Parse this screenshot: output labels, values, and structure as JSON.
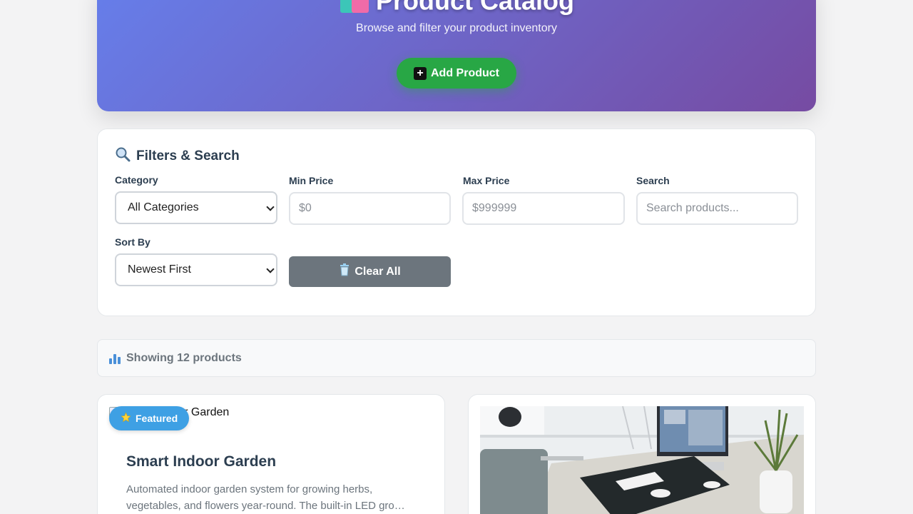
{
  "header": {
    "title": "Product Catalog",
    "subtitle": "Browse and filter your product inventory",
    "add_button": "Add Product"
  },
  "filters": {
    "title": "Filters & Search",
    "category_label": "Category",
    "category_value": "All Categories",
    "min_price_label": "Min Price",
    "min_price_placeholder": "$0",
    "max_price_label": "Max Price",
    "max_price_placeholder": "$999999",
    "search_label": "Search",
    "search_placeholder": "Search products...",
    "sort_label": "Sort By",
    "sort_value": "Newest First",
    "clear_button": "Clear All"
  },
  "results": {
    "count_text": "Showing 12 products"
  },
  "products": [
    {
      "image_alt": "Smart Indoor Garden",
      "badge": "Featured",
      "name": "Smart Indoor Garden",
      "description": "Automated indoor garden system for growing herbs, vegetables, and flowers year-round. The built-in LED gro…"
    }
  ],
  "colors": {
    "hero_gradient_start": "#667eea",
    "hero_gradient_end": "#764ba2",
    "add_button": "#28a745",
    "clear_button": "#6c757d",
    "badge": "#3ea0e4"
  }
}
